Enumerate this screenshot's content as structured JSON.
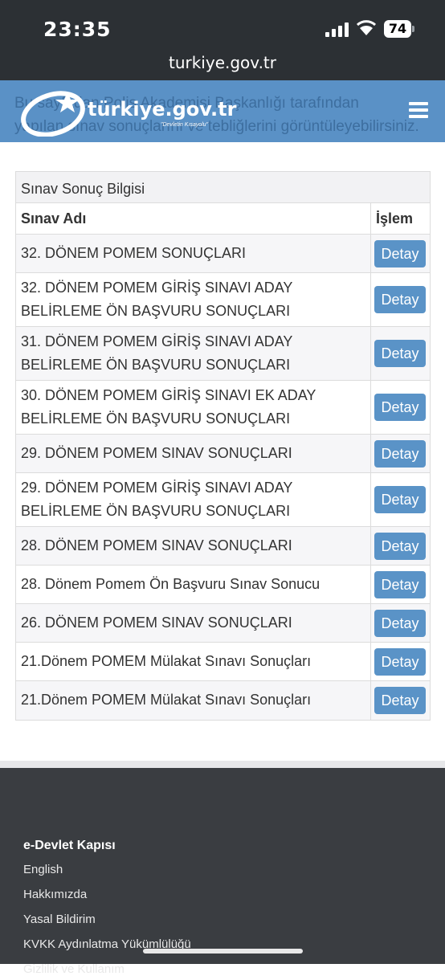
{
  "status_bar": {
    "time": "23:35",
    "battery": "74",
    "url": "turkiye.gov.tr"
  },
  "header": {
    "brand": "türkiye.gov.tr",
    "slogan": "\"Devletin Kısayolu\"",
    "background_text_1": "Bu sayfadan Polis Akademisi Başkanlığı tarafından",
    "background_text_2": "yapılan sınav sonuçlarını ve tebliğlerini görüntüleyebilirsiniz."
  },
  "panel": {
    "title": "Sınav Sonuç Bilgisi",
    "col_name": "Sınav Adı",
    "col_action": "İşlem",
    "button_label": "Detay",
    "rows": [
      {
        "name": "32. DÖNEM POMEM SONUÇLARI"
      },
      {
        "name": "32. DÖNEM POMEM GİRİŞ SINAVI ADAY BELİRLEME ÖN BAŞVURU SONUÇLARI"
      },
      {
        "name": "31. DÖNEM POMEM GİRİŞ SINAVI ADAY BELİRLEME ÖN BAŞVURU SONUÇLARI"
      },
      {
        "name": "30. DÖNEM POMEM GİRİŞ SINAVI EK ADAY BELİRLEME ÖN BAŞVURU SONUÇLARI"
      },
      {
        "name": "29. DÖNEM POMEM SINAV SONUÇLARI"
      },
      {
        "name": "29. DÖNEM POMEM GİRİŞ SINAVI ADAY BELİRLEME ÖN BAŞVURU SONUÇLARI"
      },
      {
        "name": "28. DÖNEM POMEM SINAV SONUÇLARI"
      },
      {
        "name": "28. Dönem Pomem Ön Başvuru Sınav Sonucu"
      },
      {
        "name": "26. DÖNEM POMEM SINAV SONUÇLARI"
      },
      {
        "name": "21.Dönem POMEM Mülakat Sınavı Sonuçları"
      },
      {
        "name": "21.Dönem POMEM Mülakat Sınavı Sonuçları"
      }
    ]
  },
  "footer": {
    "title": "e-Devlet Kapısı",
    "links": [
      "English",
      "Hakkımızda",
      "Yasal Bildirim",
      "KVKK Aydınlatma Yükümlülüğü",
      "Gizlilik ve Kullanım"
    ]
  }
}
